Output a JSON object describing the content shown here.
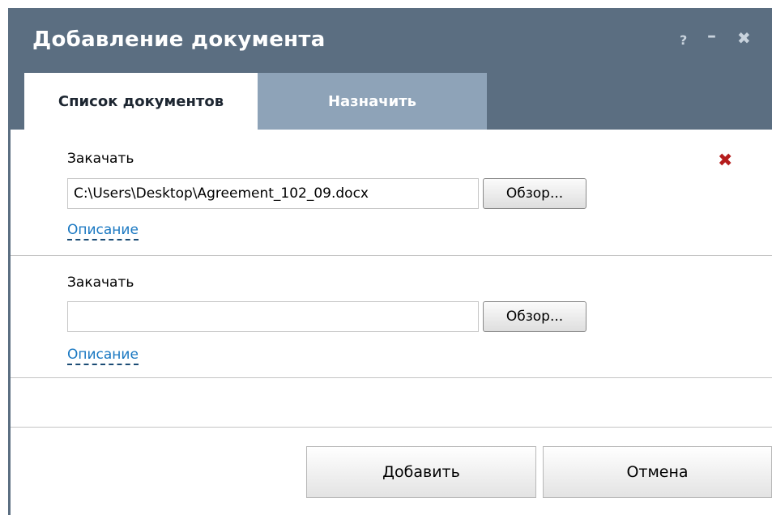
{
  "dialog": {
    "title": "Добавление документа",
    "controls": {
      "help": "?",
      "minimize": "–",
      "close": "✖"
    }
  },
  "tabs": [
    {
      "label": "Список документов",
      "active": true
    },
    {
      "label": "Назначить",
      "active": false
    }
  ],
  "uploads": [
    {
      "label": "Закачать",
      "value": "C:\\Users\\Desktop\\Agreement_102_09.docx",
      "browse_label": "Обзор...",
      "description_link": "Описание",
      "remove_icon": "✖"
    },
    {
      "label": "Закачать",
      "value": "",
      "browse_label": "Обзор...",
      "description_link": "Описание"
    }
  ],
  "footer": {
    "add_label": "Добавить",
    "cancel_label": "Отмена"
  },
  "colors": {
    "header": "#5b6e81",
    "inactive_tab": "#8ea3b8",
    "link": "#1a78c2",
    "remove": "#b51d1d"
  }
}
